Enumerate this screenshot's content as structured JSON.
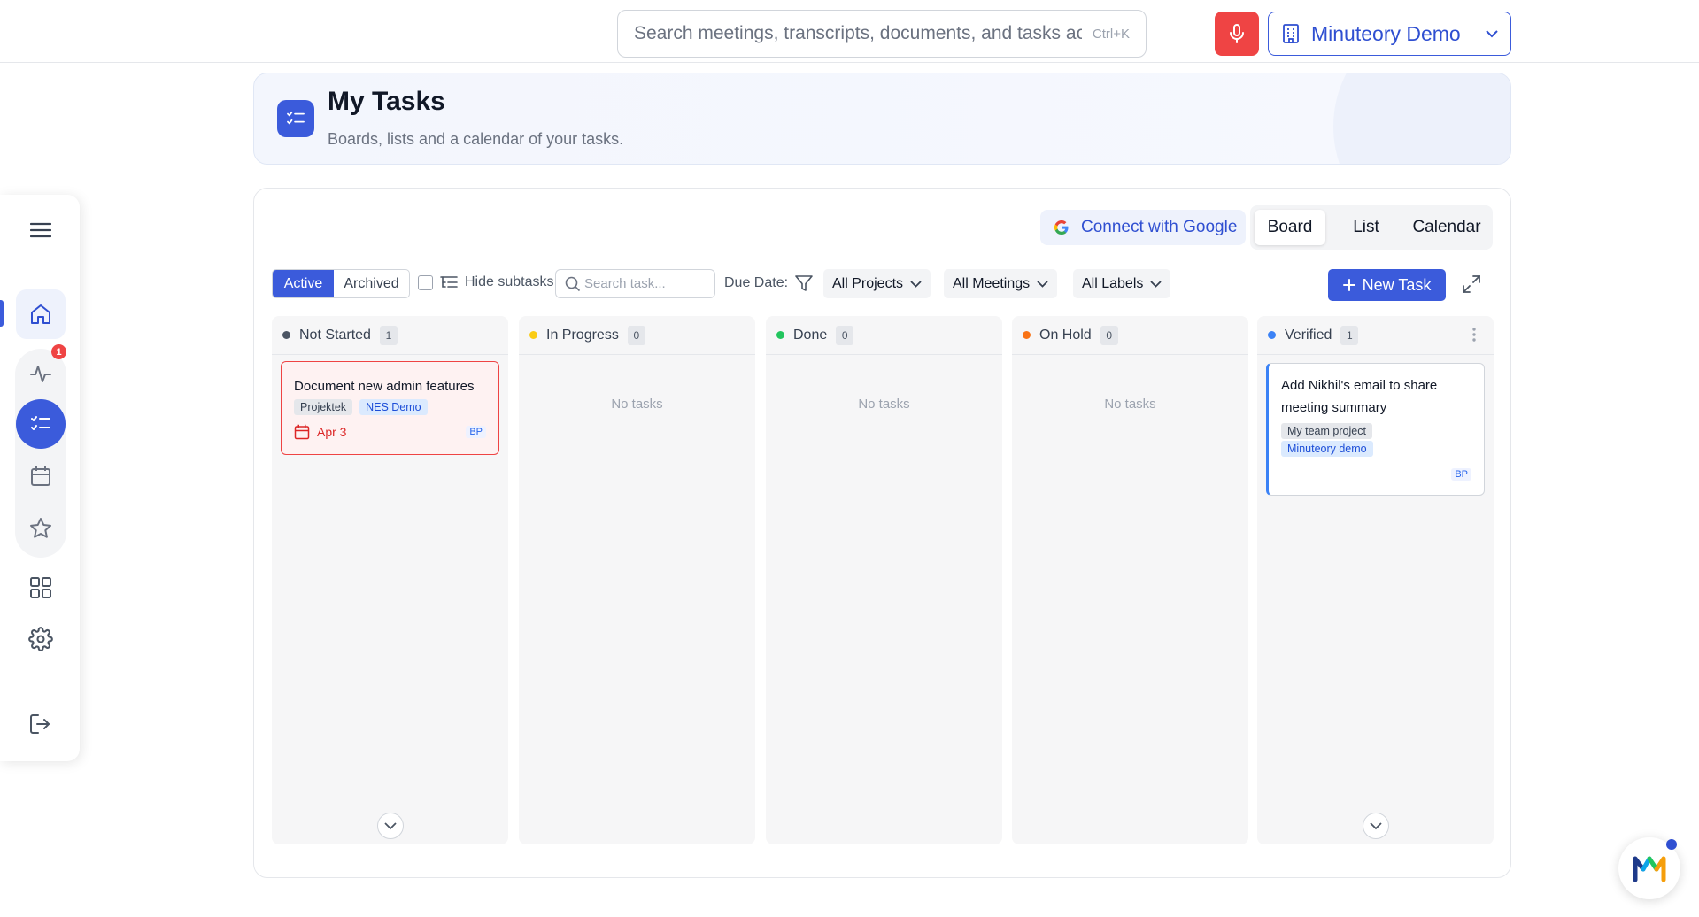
{
  "topbar": {
    "search_placeholder": "Search meetings, transcripts, documents, and tasks across",
    "search_shortcut": "Ctrl+K",
    "org_name": "Minuteory Demo"
  },
  "sidebar": {
    "notification_count": "1"
  },
  "header": {
    "title": "My Tasks",
    "subtitle": "Boards, lists and a calendar of your tasks."
  },
  "views": {
    "connect_google": "Connect with Google",
    "tabs": [
      "Board",
      "List",
      "Calendar"
    ],
    "active_tab": "Board"
  },
  "toolbar": {
    "status_filter": [
      "Active",
      "Archived"
    ],
    "hide_subtasks": "Hide subtasks",
    "search_placeholder": "Search task...",
    "due_date": "Due Date:",
    "projects": "All Projects",
    "meetings": "All Meetings",
    "labels": "All Labels",
    "new_task": "New Task"
  },
  "board": {
    "empty_text": "No tasks",
    "columns": [
      {
        "name": "Not Started",
        "count": "1",
        "color": "#4b5563"
      },
      {
        "name": "In Progress",
        "count": "0",
        "color": "#facc15"
      },
      {
        "name": "Done",
        "count": "0",
        "color": "#22c55e"
      },
      {
        "name": "On Hold",
        "count": "0",
        "color": "#f97316"
      },
      {
        "name": "Verified",
        "count": "1",
        "color": "#3b82f6"
      }
    ],
    "cards": {
      "not_started": {
        "title": "Document new admin features",
        "tags": [
          "Projektek",
          "NES Demo"
        ],
        "due": "Apr 3",
        "assignee": "BP"
      },
      "verified": {
        "title": "Add Nikhil's email to share meeting summary",
        "tags": [
          "My team project",
          "Minuteory demo"
        ],
        "assignee": "BP"
      }
    }
  },
  "colors": {
    "accent": "#3b5bdb",
    "danger": "#ef4444"
  }
}
